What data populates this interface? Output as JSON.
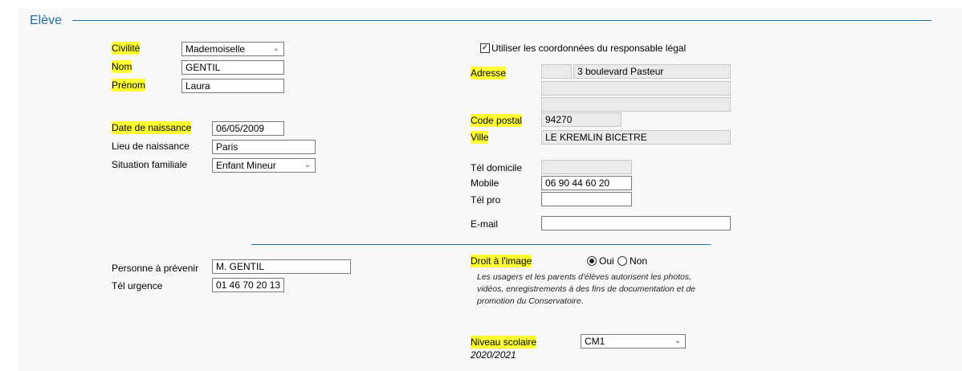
{
  "section": {
    "title": "Elève"
  },
  "identity": {
    "civilite_label": "Civilité",
    "civilite_value": "Mademoiselle",
    "nom_label": "Nom",
    "nom_value": "GENTIL",
    "prenom_label": "Prénom",
    "prenom_value": "Laura"
  },
  "birth": {
    "date_label": "Date de naissance",
    "date_value": "06/05/2009",
    "lieu_label": "Lieu de naissance",
    "lieu_value": "Paris",
    "situation_label": "Situation familiale",
    "situation_value": "Enfant Mineur"
  },
  "contact_person": {
    "personne_label": "Personne à prévenir",
    "personne_value": "M. GENTIL",
    "tel_urgence_label": "Tél urgence",
    "tel_urgence_value": "01 46 70 20 13"
  },
  "address": {
    "use_guardian_label": "Utiliser les coordonnées du responsable légal",
    "use_guardian_checked": true,
    "adresse_label": "Adresse",
    "adresse_num": "",
    "adresse_line1": "3 boulevard Pasteur",
    "adresse_line2": "",
    "adresse_line3": "",
    "cp_label": "Code postal",
    "cp_value": "94270",
    "ville_label": "Ville",
    "ville_value": "LE KREMLIN BICETRE"
  },
  "phones": {
    "domicile_label": "Tél domicile",
    "domicile_value": "",
    "mobile_label": "Mobile",
    "mobile_value": "06 90 44 60 20",
    "pro_label": "Tél pro",
    "pro_value": "",
    "email_label": "E-mail",
    "email_value": ""
  },
  "image_rights": {
    "label": "Droit à l'image",
    "oui_label": "Oui",
    "non_label": "Non",
    "selected": "Oui",
    "note": "Les usagers et les parents d'élèves autorisent les photos, vidéos, enregistrements à des fins de documentation et de promotion du Conservatoire."
  },
  "school": {
    "label": "Niveau scolaire",
    "year": "2020/2021",
    "value": "CM1"
  },
  "colors": {
    "accent": "#1f6ea8",
    "highlight": "#ffff33"
  }
}
